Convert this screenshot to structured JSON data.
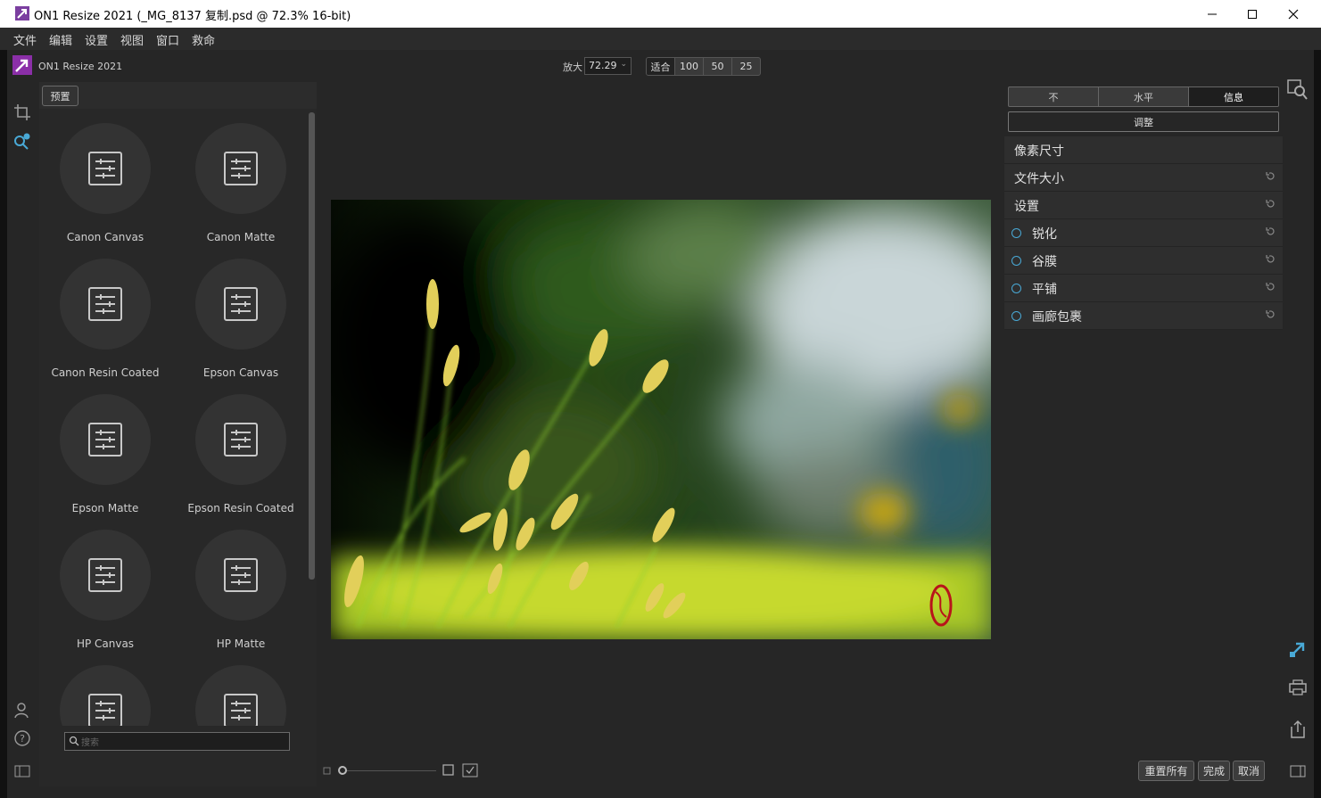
{
  "window": {
    "title": "ON1 Resize 2021 (_MG_8137 复制.psd @ 72.3% 16-bit)"
  },
  "menu": [
    "文件",
    "编辑",
    "设置",
    "视图",
    "窗口",
    "救命"
  ],
  "brand": {
    "name": "ON1 Resize 2021"
  },
  "left_tools": [
    "crop-icon",
    "resize-lens-icon",
    "user-icon",
    "help-icon",
    "panel-toggle-icon"
  ],
  "presets": {
    "button": "预置",
    "items": [
      {
        "label": "Canon Canvas"
      },
      {
        "label": "Canon Matte"
      },
      {
        "label": "Canon Resin Coated"
      },
      {
        "label": "Epson Canvas"
      },
      {
        "label": "Epson Matte"
      },
      {
        "label": "Epson Resin Coated"
      },
      {
        "label": "HP Canvas"
      },
      {
        "label": "HP Matte"
      },
      {
        "label": ""
      },
      {
        "label": ""
      }
    ],
    "search_placeholder": "搜索"
  },
  "zoom": {
    "label": "放大",
    "value": "72.29",
    "buttons": [
      "适合",
      "100",
      "50",
      "25"
    ]
  },
  "right_panel": {
    "tabs": [
      "不",
      "水平",
      "信息"
    ],
    "active_tab": 2,
    "adjust_label": "调整",
    "sections": [
      {
        "label": "像素尺寸",
        "reset": false,
        "radio": false
      },
      {
        "label": "文件大小",
        "reset": true,
        "radio": false
      },
      {
        "label": "设置",
        "reset": true,
        "radio": false
      },
      {
        "label": "锐化",
        "reset": true,
        "radio": true
      },
      {
        "label": "谷膜",
        "reset": true,
        "radio": true
      },
      {
        "label": "平铺",
        "reset": true,
        "radio": true
      },
      {
        "label": "画廊包裹",
        "reset": true,
        "radio": true
      }
    ]
  },
  "bottom": {
    "thumb_slider_value": 0,
    "buttons": [
      "重置所有",
      "完成",
      "取消"
    ]
  },
  "colors": {
    "accent": "#49a9d6",
    "brand": "#8b2fa8",
    "panel": "#2e2e2e"
  }
}
